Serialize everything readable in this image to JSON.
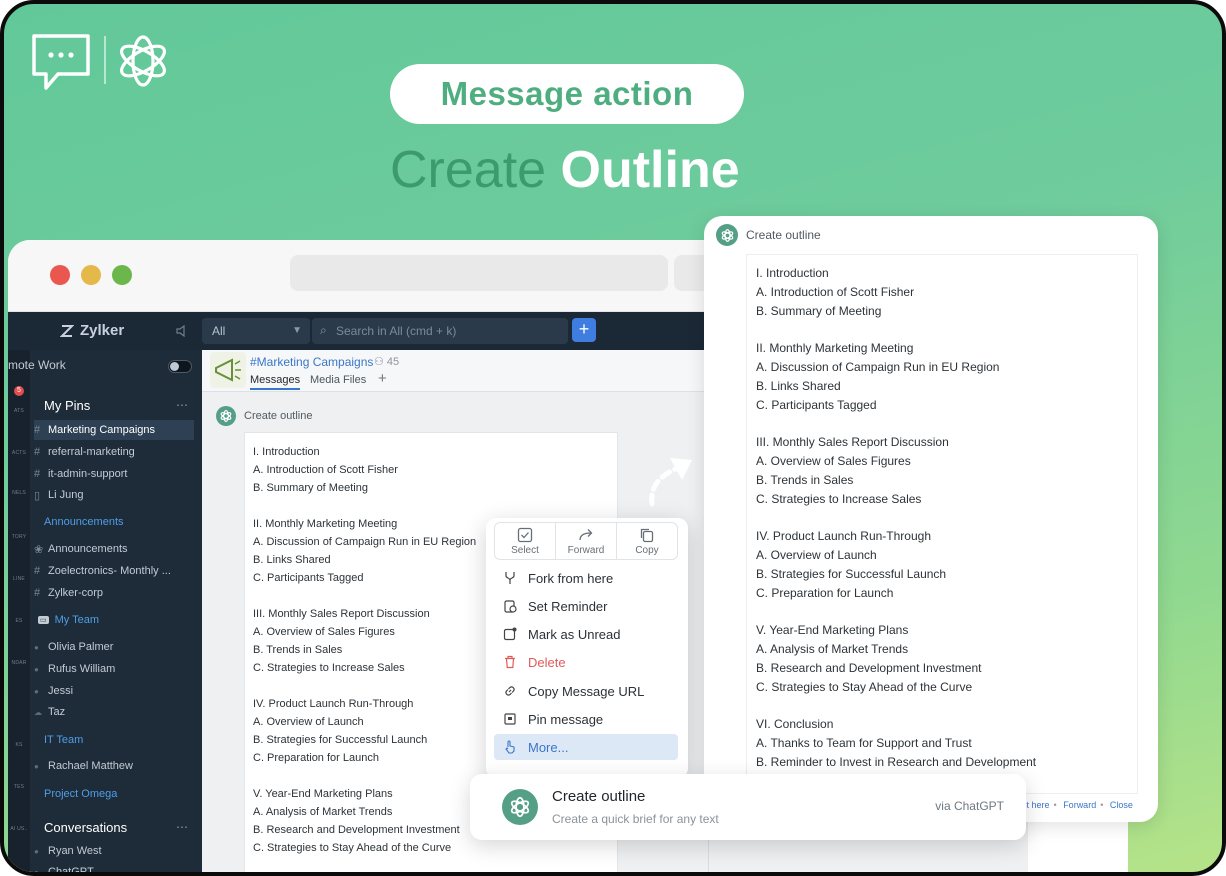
{
  "hero": {
    "pill_label": "Message action",
    "headline_light": "Create",
    "headline_bold": "Outline"
  },
  "app": {
    "brand": "Zylker",
    "filter_value": "All",
    "search_placeholder": "Search in All (cmd + k)",
    "remote_label": "mote Work",
    "rail_labels": [
      "ATS",
      "ACTS",
      "NELS",
      "TORY",
      "LINE",
      "ES",
      "NDAR",
      "KS",
      "TES",
      "AI US.."
    ],
    "rail_badge": "5"
  },
  "sidebar": {
    "my_pins": "My Pins",
    "pins": [
      "Marketing Campaigns",
      "referral-marketing",
      "it-admin-support",
      "Li Jung"
    ],
    "announcements_section": "Announcements",
    "announcements": [
      "Announcements",
      "Zoelectronics- Monthly ...",
      "Zylker-corp"
    ],
    "my_team": "My Team",
    "team": [
      "Olivia Palmer",
      "Rufus William",
      "Jessi",
      "Taz"
    ],
    "it_team": "IT Team",
    "it_members": [
      "Rachael Matthew"
    ],
    "project_omega": "Project Omega",
    "conversations": "Conversations",
    "convos": [
      "Ryan West",
      "ChatGPT"
    ]
  },
  "channel": {
    "name": "#Marketing Campaigns",
    "member_count": "45",
    "tabs": [
      "Messages",
      "Media Files"
    ],
    "message_title": "Create outline",
    "outline": [
      "I. Introduction",
      "A. Introduction of Scott Fisher",
      "B. Summary of Meeting",
      "",
      "II. Monthly Marketing Meeting",
      "A. Discussion of Campaign Run in EU Region",
      "B. Links Shared",
      "C. Participants Tagged",
      "",
      "III. Monthly Sales Report Discussion",
      "A. Overview of Sales Figures",
      "B. Trends in Sales",
      "C. Strategies to Increase Sales",
      "",
      "IV. Product Launch Run-Through",
      "A. Overview of Launch",
      "B. Strategies for Successful Launch",
      "C. Preparation for Launch",
      "",
      "V. Year-End Marketing Plans",
      "A. Analysis of Market Trends",
      "B. Research and Development Investment",
      "C. Strategies to Stay Ahead of the Curve"
    ]
  },
  "menu": {
    "top": [
      "Select",
      "Forward",
      "Copy"
    ],
    "items": [
      "Fork from here",
      "Set Reminder",
      "Mark as Unread",
      "Delete",
      "Copy Message URL",
      "Pin message",
      "More..."
    ]
  },
  "card": {
    "title": "Create outline",
    "outline": [
      "I. Introduction",
      "A. Introduction of Scott Fisher",
      "B. Summary of Meeting",
      "",
      "II. Monthly Marketing Meeting",
      "A. Discussion of Campaign Run in EU Region",
      "B. Links Shared",
      "C. Participants Tagged",
      "",
      "III. Monthly Sales Report Discussion",
      "A. Overview of Sales Figures",
      "B. Trends in Sales",
      "C. Strategies to Increase Sales",
      "",
      "IV. Product Launch Run-Through",
      "A. Overview of Launch",
      "B. Strategies for Successful Launch",
      "C. Preparation for Launch",
      "",
      "V. Year-End Marketing Plans",
      "A. Analysis of Market Trends",
      "B. Research and Development Investment",
      "C. Strategies to Stay Ahead of the Curve",
      "",
      "VI. Conclusion",
      "A. Thanks to Team for Support and Trust",
      "B. Reminder to Invest in Research and Development"
    ],
    "footer": [
      "st here",
      "Forward",
      "Close"
    ]
  },
  "suggest": {
    "title": "Create outline",
    "subtitle": "Create a quick brief for any text",
    "via": "via ChatGPT"
  },
  "colors": {
    "brand_green": "#4fae7f",
    "accent_blue": "#3a76c8",
    "sidebar_bg": "#1e2b38"
  }
}
